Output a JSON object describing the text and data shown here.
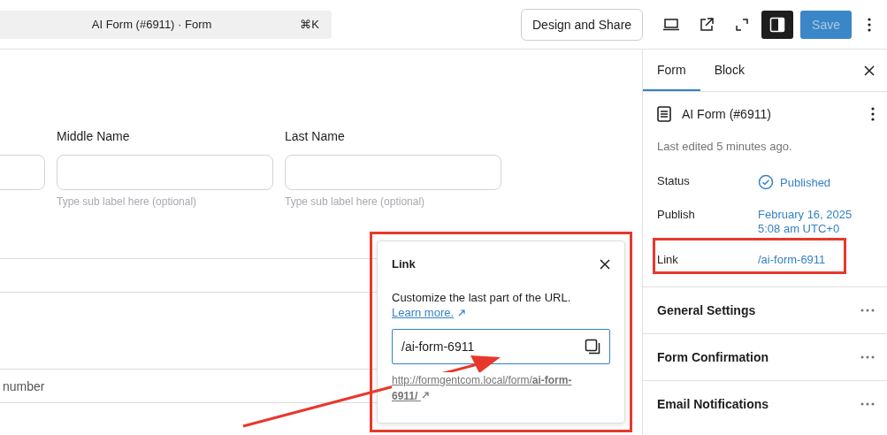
{
  "command_bar": {
    "title": "AI Form (#6911) · Form",
    "shortcut": "⌘K"
  },
  "toolbar": {
    "design_button": "Design and Share",
    "sidebar_toggle_on": true,
    "save": {
      "label": "Save",
      "disabled": true
    }
  },
  "canvas": {
    "fields": [
      {
        "label": "Middle Name",
        "sub_label": "Type sub label here (optional)"
      },
      {
        "label": "Last Name",
        "sub_label": "Type sub label here (optional)"
      }
    ],
    "phone_placeholder": "number"
  },
  "link_popover": {
    "title": "Link",
    "description": "Customize the last part of the URL.",
    "learn_more": "Learn more.",
    "slug": "/ai-form-6911",
    "url": "http://formgentcom.local/form/**ai-form-6911/**"
  },
  "sidebar": {
    "tabs": [
      {
        "label": "Form",
        "selected": true
      },
      {
        "label": "Block",
        "selected": false
      }
    ],
    "title": "AI Form (#6911)",
    "last_edited": "Last edited 5 minutes ago.",
    "rows": [
      {
        "kind": "status",
        "label": "Status",
        "value": "Published"
      },
      {
        "kind": "date",
        "label": "Publish",
        "value": "February 16, 2025 5:08 am UTC+0"
      },
      {
        "kind": "link",
        "label": "Link",
        "value": "/ai-form-6911"
      }
    ],
    "panels": [
      "General Settings",
      "Form Confirmation",
      "Email Notifications"
    ]
  }
}
